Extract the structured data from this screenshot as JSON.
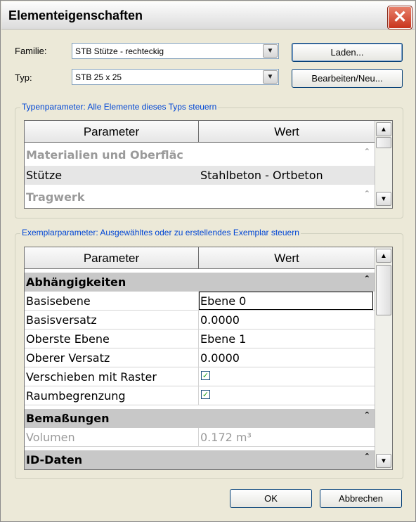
{
  "window": {
    "title": "Elementeigenschaften",
    "close_glyph": "✕"
  },
  "family": {
    "label": "Familie:",
    "value": "STB Stütze - rechteckig",
    "button": "Laden..."
  },
  "type": {
    "label": "Typ:",
    "value": "STB 25 x 25",
    "button": "Bearbeiten/Neu..."
  },
  "type_params": {
    "group_title": "Typenparameter: Alle Elemente dieses Typs steuern",
    "headers": [
      "Parameter",
      "Wert"
    ],
    "rows": [
      {
        "kind": "category",
        "name": "Materialien und Oberfläc"
      },
      {
        "kind": "value",
        "name": "Stütze",
        "value": "Stahlbeton - Ortbeton"
      },
      {
        "kind": "category",
        "name": "Tragwerk"
      }
    ]
  },
  "instance_params": {
    "group_title": "Exemplarparameter: Ausgewähltes oder zu erstellendes Exemplar steuern",
    "headers": [
      "Parameter",
      "Wert"
    ],
    "rows": [
      {
        "kind": "category",
        "name": "Abhängigkeiten"
      },
      {
        "kind": "value",
        "name": "Basisebene",
        "value": "Ebene 0",
        "editing": true
      },
      {
        "kind": "value",
        "name": "Basisversatz",
        "value": "0.0000"
      },
      {
        "kind": "value",
        "name": "Oberste Ebene",
        "value": "Ebene 1"
      },
      {
        "kind": "value",
        "name": "Oberer Versatz",
        "value": "0.0000"
      },
      {
        "kind": "check",
        "name": "Verschieben mit Raster",
        "checked": true
      },
      {
        "kind": "check",
        "name": "Raumbegrenzung",
        "checked": true
      },
      {
        "kind": "category",
        "name": "Bemaßungen"
      },
      {
        "kind": "readonly",
        "name": "Volumen",
        "value": "0.172 m³"
      },
      {
        "kind": "category",
        "name": "ID-Daten"
      }
    ]
  },
  "buttons": {
    "ok": "OK",
    "cancel": "Abbrechen"
  },
  "icons": {
    "combo_arrow": "chevron-down-icon",
    "collapse": "double-chevron-up-icon",
    "check": "check-icon"
  },
  "colors": {
    "group_title": "#0046d5",
    "category_bg": "#c8c8c8",
    "close_button": "#c8331c"
  }
}
